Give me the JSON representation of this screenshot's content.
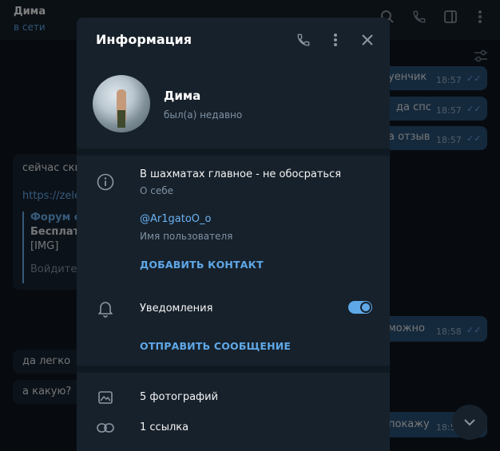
{
  "chat": {
    "contact_name": "Дима",
    "contact_status": "в сети",
    "messages_in": [
      {
        "text": "сейчас ски"
      },
      {
        "text": "https://zele"
      },
      {
        "text": "Форум со"
      },
      {
        "text": "Бесплатн"
      },
      {
        "text": "[IMG]"
      },
      {
        "text": "Войдите и"
      },
      {
        "text": "да легко"
      },
      {
        "text": "а какую?"
      }
    ],
    "messages_out": [
      {
        "text": "уенчик",
        "time": "18:57"
      },
      {
        "text": "да спс",
        "time": "18:57"
      },
      {
        "text": "а отзыв",
        "time": "18:57"
      },
      {
        "text": "можно",
        "time": "18:58"
      },
      {
        "text": "покажу",
        "time": "18:5"
      }
    ]
  },
  "info_panel": {
    "title": "Информация",
    "user": {
      "name": "Дима",
      "last_seen": "был(а) недавно"
    },
    "bio": {
      "text": "В шахматах главное - не обосраться",
      "label": "О себе"
    },
    "username": {
      "value": "@Ar1gatoO_o",
      "label": "Имя пользователя"
    },
    "add_contact_label": "ДОБАВИТЬ КОНТАКТ",
    "notifications": {
      "label": "Уведомления",
      "enabled": true
    },
    "send_message_label": "ОТПРАВИТЬ СООБЩЕНИЕ",
    "media": {
      "photos_label": "5 фотографий",
      "links_label": "1 ссылка"
    }
  },
  "colors": {
    "accent": "#5fa8e8",
    "panel_bg": "#17212b",
    "chat_bg": "#0e1621",
    "outgoing_bubble": "#2b5278"
  }
}
